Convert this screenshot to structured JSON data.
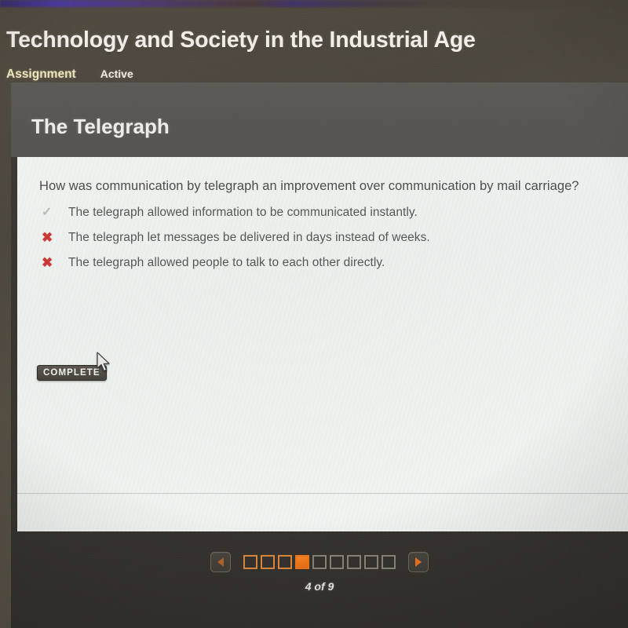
{
  "app": {
    "title": "Technology and Society in the Industrial Age",
    "type_label": "Assignment",
    "status_label": "Active"
  },
  "lesson": {
    "title": "The Telegraph"
  },
  "question": {
    "prompt": "How was communication by telegraph an improvement over communication by mail carriage?",
    "choices": [
      {
        "mark": "check-icon",
        "mark_glyph": "✓",
        "state": "correct",
        "text": "The telegraph allowed information to be communicated instantly."
      },
      {
        "mark": "cross-icon",
        "mark_glyph": "✖",
        "state": "wrong",
        "text": "The telegraph let messages be delivered in days instead of weeks."
      },
      {
        "mark": "cross-icon",
        "mark_glyph": "✖",
        "state": "wrong",
        "text": "The telegraph allowed people to talk to each other directly."
      }
    ]
  },
  "complete_badge": {
    "label": "COMPLETE"
  },
  "pagination": {
    "prev_icon": "triangle-left-icon",
    "next_icon": "triangle-right-icon",
    "current_page": 4,
    "total_pages": 9,
    "page_label": "4 of 9",
    "steps": [
      {
        "index": 1,
        "state": "visited"
      },
      {
        "index": 2,
        "state": "visited"
      },
      {
        "index": 3,
        "state": "visited"
      },
      {
        "index": 4,
        "state": "current"
      },
      {
        "index": 5,
        "state": "future"
      },
      {
        "index": 6,
        "state": "future"
      },
      {
        "index": 7,
        "state": "future"
      },
      {
        "index": 8,
        "state": "future"
      },
      {
        "index": 9,
        "state": "future"
      }
    ]
  },
  "colors": {
    "accent_orange": "#ef6f13",
    "visited_orange": "#e08a3c",
    "future_gray": "#8a867c",
    "wrong_red": "#cc3939",
    "correct_gray": "#bdbdb8",
    "assignment_cream": "#efe7bf",
    "panel_white": "#f2f3f0",
    "header_gray": "#595752",
    "frame_dark": "#383530",
    "desktop_olive": "#514b40",
    "purple_strip": "#4d3aa0"
  }
}
